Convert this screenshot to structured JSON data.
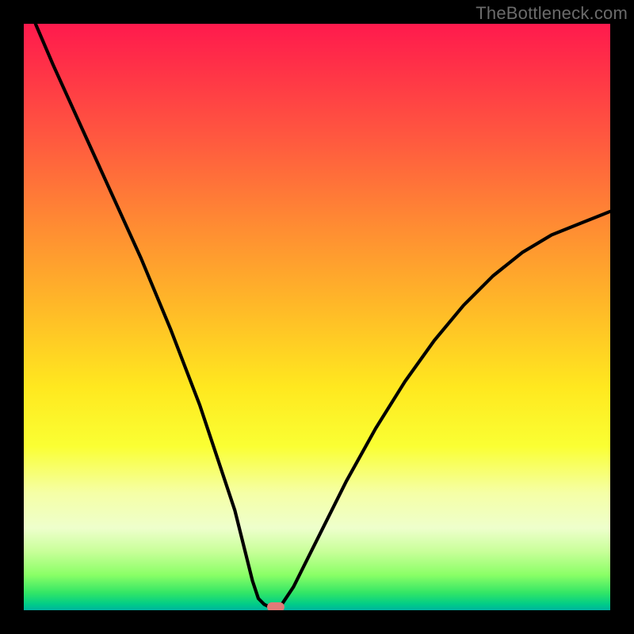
{
  "watermark": "TheBottleneck.com",
  "chart_data": {
    "type": "line",
    "title": "",
    "xlabel": "",
    "ylabel": "",
    "xlim": [
      0,
      100
    ],
    "ylim": [
      0,
      100
    ],
    "grid": false,
    "series": [
      {
        "name": "bottleneck-curve",
        "x": [
          2,
          5,
          10,
          15,
          20,
          25,
          30,
          33,
          36,
          38,
          39,
          40,
          41,
          42,
          43,
          44,
          46,
          50,
          55,
          60,
          65,
          70,
          75,
          80,
          85,
          90,
          95,
          100
        ],
        "y": [
          100,
          93,
          82,
          71,
          60,
          48,
          35,
          26,
          17,
          9,
          5,
          2,
          1,
          0.5,
          0.5,
          1,
          4,
          12,
          22,
          31,
          39,
          46,
          52,
          57,
          61,
          64,
          66,
          68
        ]
      }
    ],
    "marker": {
      "x": 43,
      "y": 0.5
    },
    "background_gradient": {
      "direction": "vertical",
      "stops": [
        {
          "pos": 0,
          "color": "#ff1a4d"
        },
        {
          "pos": 20,
          "color": "#ff5a3f"
        },
        {
          "pos": 48,
          "color": "#ffb828"
        },
        {
          "pos": 72,
          "color": "#faff33"
        },
        {
          "pos": 90,
          "color": "#c8ff99"
        },
        {
          "pos": 100,
          "color": "#00b3a0"
        }
      ]
    }
  }
}
